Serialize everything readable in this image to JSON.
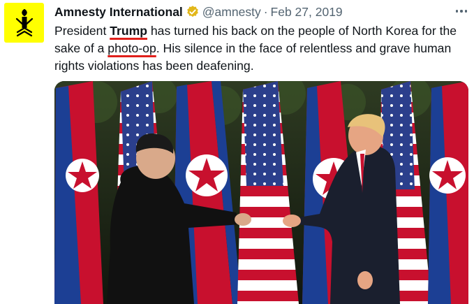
{
  "tweet": {
    "author_name": "Amnesty International",
    "handle": "@amnesty",
    "separator": "·",
    "date": "Feb 27, 2019",
    "text_lines": [
      {
        "a": "President ",
        "b": "Trump",
        "c": " has turned his back on the people of North Korea for the"
      },
      {
        "a": "sake of a ",
        "b": "photo-op",
        "c": ". His silence in the face of relentless and grave human"
      },
      {
        "a": "rights violations has been deafening.",
        "b": "",
        "c": ""
      }
    ],
    "icons": {
      "avatar": "amnesty-candle-logo",
      "verified": "gold-verified-badge",
      "more": "more-options-icon"
    },
    "colors": {
      "avatar_bg": "#ffff00",
      "verified": "#e2b719",
      "handle": "#536471",
      "annotation_underline": "#e0201b"
    }
  }
}
